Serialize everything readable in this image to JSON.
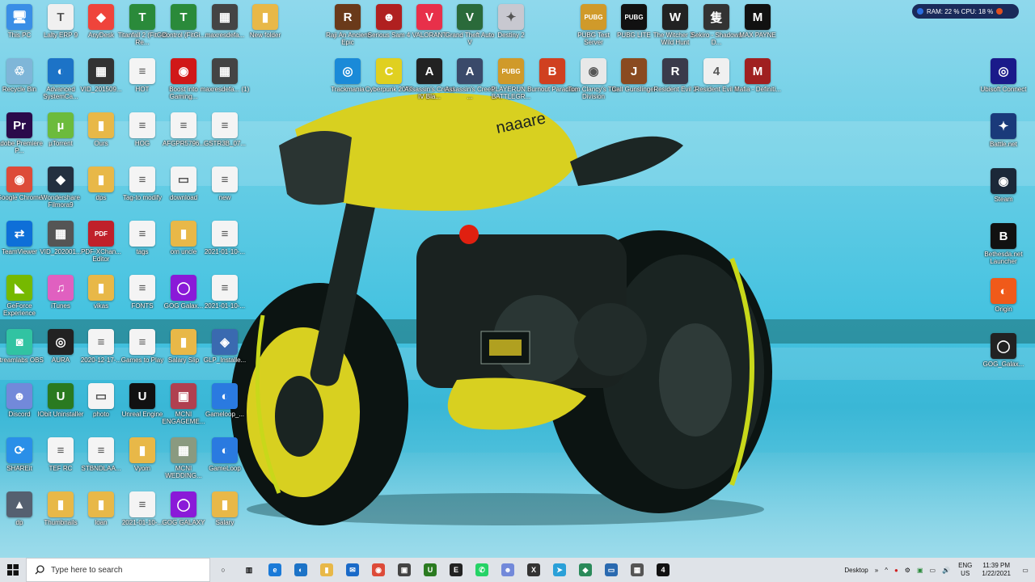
{
  "desktop": {
    "icons": [
      {
        "label": "This PC",
        "glyph": "🖥",
        "color": "#3a8ee6"
      },
      {
        "label": "Recycle Bin",
        "glyph": "♲",
        "color": "#7fb6d8"
      },
      {
        "label": "Adobe Premiere P...",
        "glyph": "Pr",
        "color": "#2a0a4a"
      },
      {
        "label": "Google Chrome",
        "glyph": "◉",
        "color": "#dd4b39"
      },
      {
        "label": "TeamViewer",
        "glyph": "⇄",
        "color": "#0e6fd8"
      },
      {
        "label": "GeForce Experience",
        "glyph": "◣",
        "color": "#76b900"
      },
      {
        "label": "Streamlabs OBS",
        "glyph": "◙",
        "color": "#31c3a2"
      },
      {
        "label": "Discord",
        "glyph": "☻",
        "color": "#7289da"
      },
      {
        "label": "SHAREit",
        "glyph": "⟳",
        "color": "#2a8fe8"
      },
      {
        "label": "dp",
        "glyph": "▲",
        "color": "#556070"
      },
      {
        "label": "Lalty ERP 9",
        "glyph": "T",
        "color": "#f0f0f0"
      },
      {
        "label": "Advanced SystemCa...",
        "glyph": "◐",
        "color": "#1c73c7"
      },
      {
        "label": "µTorrent",
        "glyph": "µ",
        "color": "#6cbb3c"
      },
      {
        "label": "Wondershare Filmora9",
        "glyph": "◆",
        "color": "#233040"
      },
      {
        "label": "VID_202001...",
        "glyph": "▦",
        "color": "#555"
      },
      {
        "label": "iTunes",
        "glyph": "♫",
        "color": "#e060c0"
      },
      {
        "label": "AURA",
        "glyph": "◎",
        "color": "#222"
      },
      {
        "label": "IObit Uninstaller",
        "glyph": "U",
        "color": "#2a7a20"
      },
      {
        "label": "TEF RC",
        "glyph": "≡",
        "color": "#f4f4f4"
      },
      {
        "label": "Thumbnails",
        "glyph": "▮",
        "color": "#e8b848"
      },
      {
        "label": "AnyDesk",
        "glyph": "◆",
        "color": "#ef443b"
      },
      {
        "label": "VID_201509...",
        "glyph": "▦",
        "color": "#333"
      },
      {
        "label": "Ours",
        "glyph": "▮",
        "color": "#e8b848"
      },
      {
        "label": "dps",
        "glyph": "▮",
        "color": "#e8b848"
      },
      {
        "label": "PDF-XChan... Editor",
        "glyph": "PDF",
        "color": "#c0202a"
      },
      {
        "label": "vikas",
        "glyph": "▮",
        "color": "#e8b848"
      },
      {
        "label": "2020-12-17-...",
        "glyph": "≡",
        "color": "#f4f4f4"
      },
      {
        "label": "photo",
        "glyph": "▭",
        "color": "#f4f4f4"
      },
      {
        "label": "STBNDLAA...",
        "glyph": "≡",
        "color": "#f4f4f4"
      },
      {
        "label": "loan",
        "glyph": "▮",
        "color": "#e8b848"
      },
      {
        "label": "Titanfall 2 (FitGirl Re...",
        "glyph": "T",
        "color": "#2a8a3a"
      },
      {
        "label": "HOT",
        "glyph": "≡",
        "color": "#f4f4f4"
      },
      {
        "label": "HOG",
        "glyph": "≡",
        "color": "#f4f4f4"
      },
      {
        "label": "Tag-to modify",
        "glyph": "≡",
        "color": "#f4f4f4"
      },
      {
        "label": "tags",
        "glyph": "≡",
        "color": "#f4f4f4"
      },
      {
        "label": "FONTS",
        "glyph": "≡",
        "color": "#f4f4f4"
      },
      {
        "label": "Games to Play",
        "glyph": "≡",
        "color": "#f4f4f4"
      },
      {
        "label": "Unreal Engine",
        "glyph": "U",
        "color": "#111"
      },
      {
        "label": "Vyom",
        "glyph": "▮",
        "color": "#e8b848"
      },
      {
        "label": "2021-01-10-...",
        "glyph": "≡",
        "color": "#f4f4f4"
      },
      {
        "label": "Control (FitGi...",
        "glyph": "T",
        "color": "#2a8a3a"
      },
      {
        "label": "Boost into Gaming...",
        "glyph": "◉",
        "color": "#d01818"
      },
      {
        "label": "AFGPR5796...",
        "glyph": "≡",
        "color": "#f4f4f4"
      },
      {
        "label": "download",
        "glyph": "▭",
        "color": "#f4f4f4"
      },
      {
        "label": "om uncle",
        "glyph": "▮",
        "color": "#e8b848"
      },
      {
        "label": "GOG Galax...",
        "glyph": "◯",
        "color": "#8a1ad8"
      },
      {
        "label": "Salary Slip",
        "glyph": "▮",
        "color": "#e8b848"
      },
      {
        "label": "MCNI ENGAGEME...",
        "glyph": "▣",
        "color": "#b04050"
      },
      {
        "label": "MCNI WEDDING...",
        "glyph": "▦",
        "color": "#8a9a80"
      },
      {
        "label": "GOG GALAXY",
        "glyph": "◯",
        "color": "#8a1ad8"
      },
      {
        "label": "maxresdefa...",
        "glyph": "▦",
        "color": "#444"
      },
      {
        "label": "maxresdefa... (1)",
        "glyph": "▦",
        "color": "#444"
      },
      {
        "label": "GSTR3B_07...",
        "glyph": "≡",
        "color": "#f4f4f4"
      },
      {
        "label": "new",
        "glyph": "≡",
        "color": "#f4f4f4"
      },
      {
        "label": "2021-01-10-...",
        "glyph": "≡",
        "color": "#f4f4f4"
      },
      {
        "label": "2021-01-10-...",
        "glyph": "≡",
        "color": "#f4f4f4"
      },
      {
        "label": "GLP_Installe...",
        "glyph": "◈",
        "color": "#3a6ab0"
      },
      {
        "label": "Gameloop_...",
        "glyph": "◐",
        "color": "#2a7ae0"
      },
      {
        "label": "GameLoop",
        "glyph": "◐",
        "color": "#2a7ae0"
      },
      {
        "label": "Salary",
        "glyph": "▮",
        "color": "#e8b848"
      },
      {
        "label": "New folder",
        "glyph": "▮",
        "color": "#e8b848"
      },
      {
        "label": "Raji An Ancient Epic",
        "glyph": "R",
        "color": "#6a3a1a"
      },
      {
        "label": "Serious Sam 4",
        "glyph": "☻",
        "color": "#b02020"
      },
      {
        "label": "VALORANT",
        "glyph": "V",
        "color": "#e8304a"
      },
      {
        "label": "Grand Theft Auto V",
        "glyph": "V",
        "color": "#2a6a3a"
      },
      {
        "label": "Destiny 2",
        "glyph": "✦",
        "color": "#c8c8d0"
      },
      {
        "label": "PUBG Test Server",
        "glyph": "PUBG",
        "color": "#d09a2a"
      },
      {
        "label": "PUBG LITE",
        "glyph": "PUBG",
        "color": "#111"
      },
      {
        "label": "The Witcher 3 - Wild Hunt",
        "glyph": "W",
        "color": "#222"
      },
      {
        "label": "Sekiro - Shadows D...",
        "glyph": "隻",
        "color": "#333"
      },
      {
        "label": "MAX PAYNE",
        "glyph": "M",
        "color": "#111"
      },
      {
        "label": "Trackmania",
        "glyph": "◎",
        "color": "#1a8ad8"
      },
      {
        "label": "Cyberpunk 2077",
        "glyph": "C",
        "color": "#e0d020"
      },
      {
        "label": "Assassin's Creed IV Bla...",
        "glyph": "A",
        "color": "#222"
      },
      {
        "label": "Assassin's Creed ...",
        "glyph": "A",
        "color": "#3a4a6a"
      },
      {
        "label": "PLAYERUN... BATTLEGR...",
        "glyph": "PUBG",
        "color": "#d09a2a"
      },
      {
        "label": "Burnout Paradise",
        "glyph": "B",
        "color": "#d04020"
      },
      {
        "label": "Tom Clancy's The Division",
        "glyph": "◉",
        "color": "#e8e8e8"
      },
      {
        "label": "Call Gunslinger",
        "glyph": "J",
        "color": "#8a4a20"
      },
      {
        "label": "Resident Evil 2",
        "glyph": "R",
        "color": "#3a3a4a"
      },
      {
        "label": "Resident Evil 4",
        "glyph": "4",
        "color": "#f0f0f0"
      },
      {
        "label": "Mafia - Definiti...",
        "glyph": "M",
        "color": "#a02020"
      },
      {
        "label": "Ubisoft Connect",
        "glyph": "◎",
        "color": "#1a1a8a"
      },
      {
        "label": "Battle.net",
        "glyph": "✦",
        "color": "#1a3a7a"
      },
      {
        "label": "Steam",
        "glyph": "◉",
        "color": "#1b2838"
      },
      {
        "label": "Bethesda.net Launcher",
        "glyph": "B",
        "color": "#111"
      },
      {
        "label": "Origin",
        "glyph": "◐",
        "color": "#f05a1a"
      },
      {
        "label": "GOG_Galax...",
        "glyph": "◯",
        "color": "#222"
      }
    ]
  },
  "monitor": {
    "text": "RAM: 22 %  CPU: 18 %"
  },
  "taskbar": {
    "search_placeholder": "Type here to search",
    "apps": [
      {
        "name": "cortana",
        "glyph": "○",
        "color": "#dfe3e8"
      },
      {
        "name": "task-view",
        "glyph": "▥",
        "color": "#dfe3e8"
      },
      {
        "name": "edge",
        "glyph": "e",
        "color": "#1a7ad8"
      },
      {
        "name": "advanced-systemcare",
        "glyph": "◐",
        "color": "#1c73c7"
      },
      {
        "name": "file-explorer",
        "glyph": "▮",
        "color": "#e8b848"
      },
      {
        "name": "mail",
        "glyph": "✉",
        "color": "#1a6ac8"
      },
      {
        "name": "chrome",
        "glyph": "◉",
        "color": "#dd4b39"
      },
      {
        "name": "store",
        "glyph": "▣",
        "color": "#444"
      },
      {
        "name": "iobit",
        "glyph": "U",
        "color": "#2a7a20"
      },
      {
        "name": "epic-games",
        "glyph": "E",
        "color": "#222"
      },
      {
        "name": "whatsapp",
        "glyph": "✆",
        "color": "#25d366"
      },
      {
        "name": "discord",
        "glyph": "☻",
        "color": "#7289da"
      },
      {
        "name": "xbox",
        "glyph": "X",
        "color": "#333"
      },
      {
        "name": "telegram",
        "glyph": "➤",
        "color": "#2aa0d8"
      },
      {
        "name": "filmora",
        "glyph": "◆",
        "color": "#2a8a5a"
      },
      {
        "name": "remote-desktop",
        "glyph": "▭",
        "color": "#2a6ab0"
      },
      {
        "name": "calculator",
        "glyph": "▦",
        "color": "#555"
      },
      {
        "name": "resident-evil-4",
        "glyph": "4",
        "color": "#111"
      }
    ],
    "tray": {
      "desktop_label": "Desktop",
      "lang_top": "ENG",
      "lang_bottom": "US",
      "time": "11:39 PM",
      "date": "1/22/2021"
    }
  }
}
